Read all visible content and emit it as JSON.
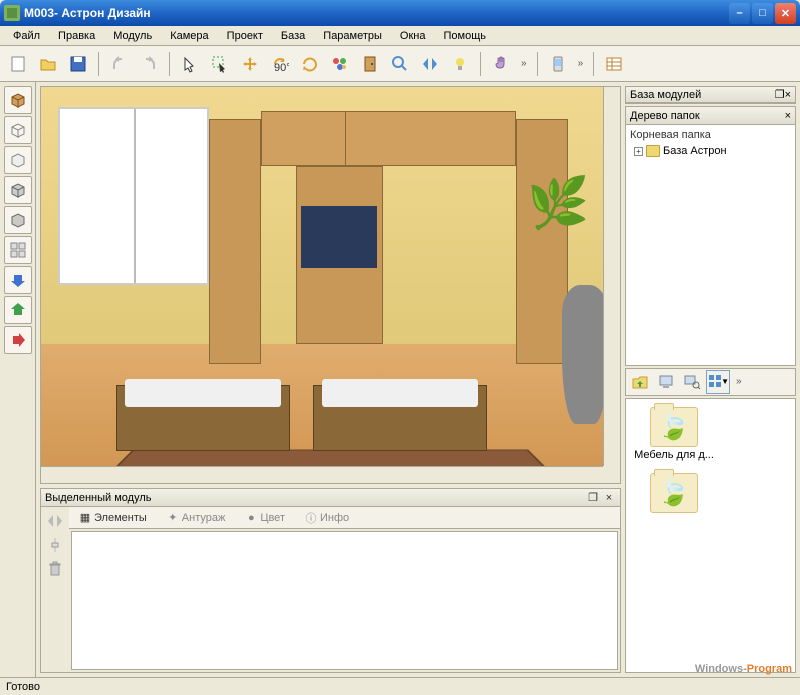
{
  "window": {
    "title": "M003- Астрон Дизайн"
  },
  "menu": {
    "items": [
      "Файл",
      "Правка",
      "Модуль",
      "Камера",
      "Проект",
      "База",
      "Параметры",
      "Окна",
      "Помощь"
    ]
  },
  "toolbar": {
    "groups": [
      [
        "new",
        "open",
        "save"
      ],
      [
        "undo",
        "redo"
      ],
      [
        "select",
        "select-area",
        "move",
        "rotate-90",
        "rotate-free",
        "color-wheel",
        "door",
        "zoom",
        "mirror-h",
        "light"
      ],
      [
        "hand",
        "more"
      ],
      [
        "phone",
        "more"
      ],
      [
        "table"
      ]
    ]
  },
  "left_tools": [
    "cube-solid",
    "cube-wire",
    "cube-flat",
    "cube-3d",
    "cube-transparent",
    "grid",
    "arrow-down-blue",
    "arrow-up-green",
    "arrow-right-red"
  ],
  "module_panel": {
    "title": "Выделенный модуль",
    "tabs": [
      "Элементы",
      "Антураж",
      "Цвет",
      "Инфо"
    ]
  },
  "right": {
    "panel1_title": "База модулей",
    "panel2_title": "Дерево папок",
    "tree_root": "Корневая папка",
    "tree_item1": "База Астрон",
    "browser_toolbar": [
      "up-folder",
      "computer",
      "search",
      "view",
      "more"
    ],
    "folders": [
      "Мебель для д...",
      ""
    ]
  },
  "status": {
    "text": "Готово"
  },
  "watermark": {
    "part1": "Windows-",
    "part2": "Program"
  }
}
